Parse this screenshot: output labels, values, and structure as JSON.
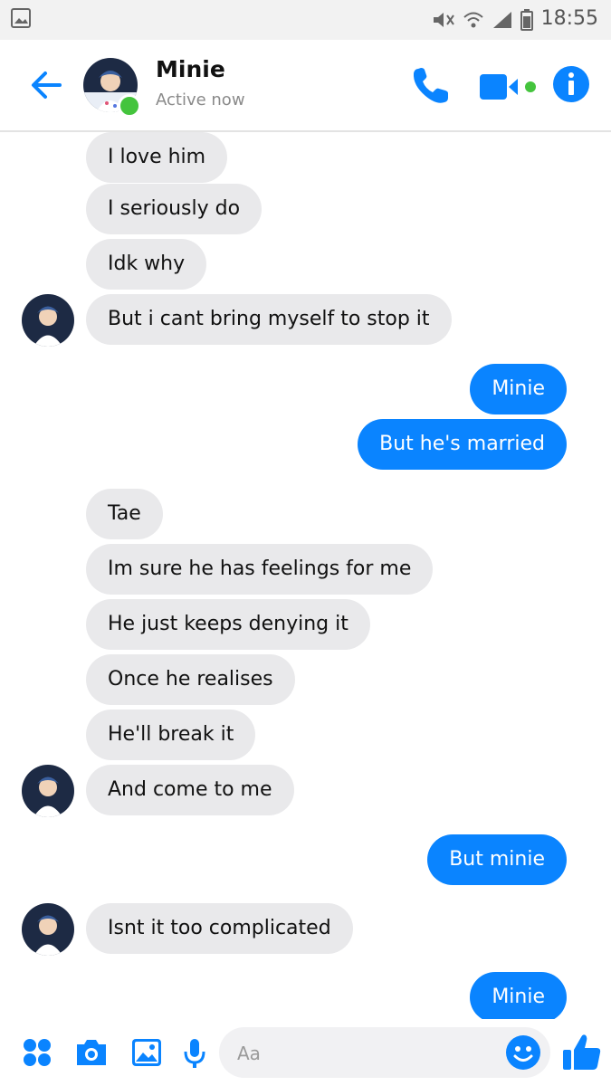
{
  "status_bar": {
    "time": "18:55",
    "icons": [
      "gallery-icon",
      "mute-icon",
      "wifi-icon",
      "signal-icon",
      "battery-icon"
    ]
  },
  "header": {
    "contact_name": "Minie",
    "contact_status": "Active now",
    "icons": [
      "back-arrow-icon",
      "phone-icon",
      "video-camera-icon",
      "info-icon"
    ],
    "accent_color": "#0a84ff",
    "presence_color": "#44c43d"
  },
  "messages": [
    {
      "side": "incoming",
      "text": "I love him"
    },
    {
      "side": "incoming",
      "text": "I seriously do"
    },
    {
      "side": "incoming",
      "text": "Idk why"
    },
    {
      "side": "incoming",
      "text": "But i cant bring myself to stop it"
    },
    {
      "side": "outgoing",
      "text": "Minie"
    },
    {
      "side": "outgoing",
      "text": "But he's married"
    },
    {
      "side": "incoming",
      "text": "Tae"
    },
    {
      "side": "incoming",
      "text": "Im sure he has feelings for me"
    },
    {
      "side": "incoming",
      "text": "He just keeps denying it"
    },
    {
      "side": "incoming",
      "text": "Once he realises"
    },
    {
      "side": "incoming",
      "text": "He'll break it"
    },
    {
      "side": "incoming",
      "text": "And come to me"
    },
    {
      "side": "outgoing",
      "text": "But minie"
    },
    {
      "side": "incoming",
      "text": "Isnt it too complicated"
    },
    {
      "side": "outgoing",
      "text": "Minie"
    }
  ],
  "composer": {
    "placeholder": "Aa",
    "value": "",
    "icons": [
      "apps-icon",
      "camera-icon",
      "image-icon",
      "microphone-icon",
      "emoji-icon",
      "thumbs-up-icon"
    ]
  },
  "colors": {
    "incoming_bubble": "#e9e9eb",
    "outgoing_bubble": "#0a84ff"
  }
}
